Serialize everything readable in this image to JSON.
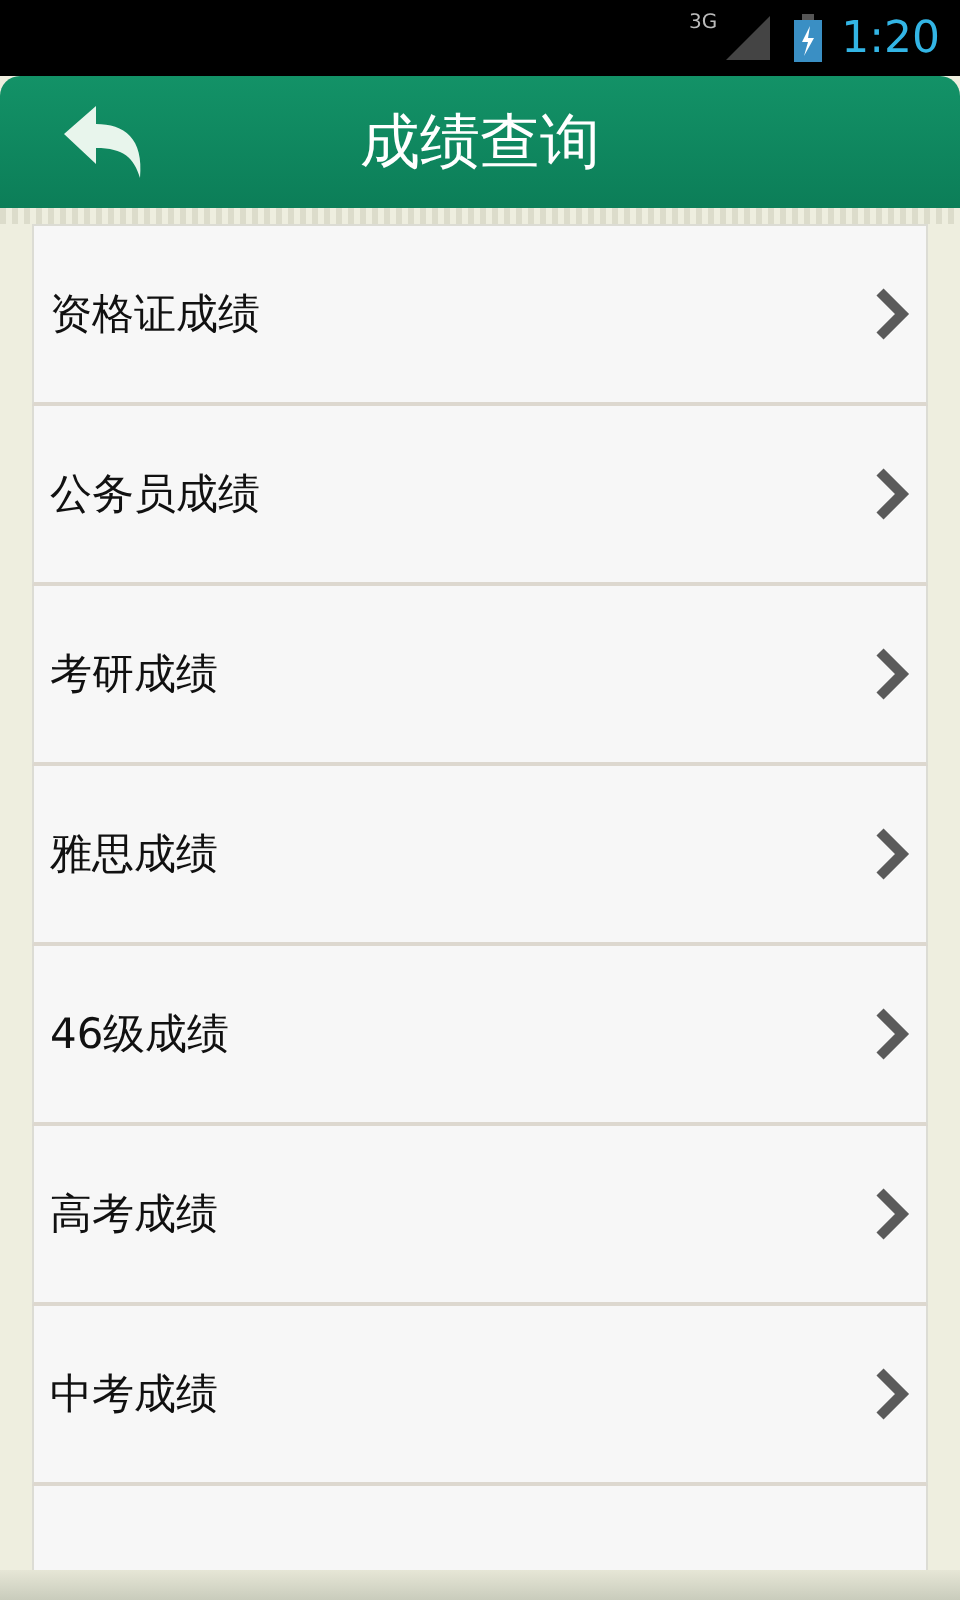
{
  "status_bar": {
    "network": "3G",
    "time": "1:20"
  },
  "header": {
    "title": "成绩查询"
  },
  "items": [
    {
      "label": "资格证成绩"
    },
    {
      "label": "公务员成绩"
    },
    {
      "label": "考研成绩"
    },
    {
      "label": "雅思成绩"
    },
    {
      "label": "46级成绩"
    },
    {
      "label": "高考成绩"
    },
    {
      "label": "中考成绩"
    }
  ]
}
